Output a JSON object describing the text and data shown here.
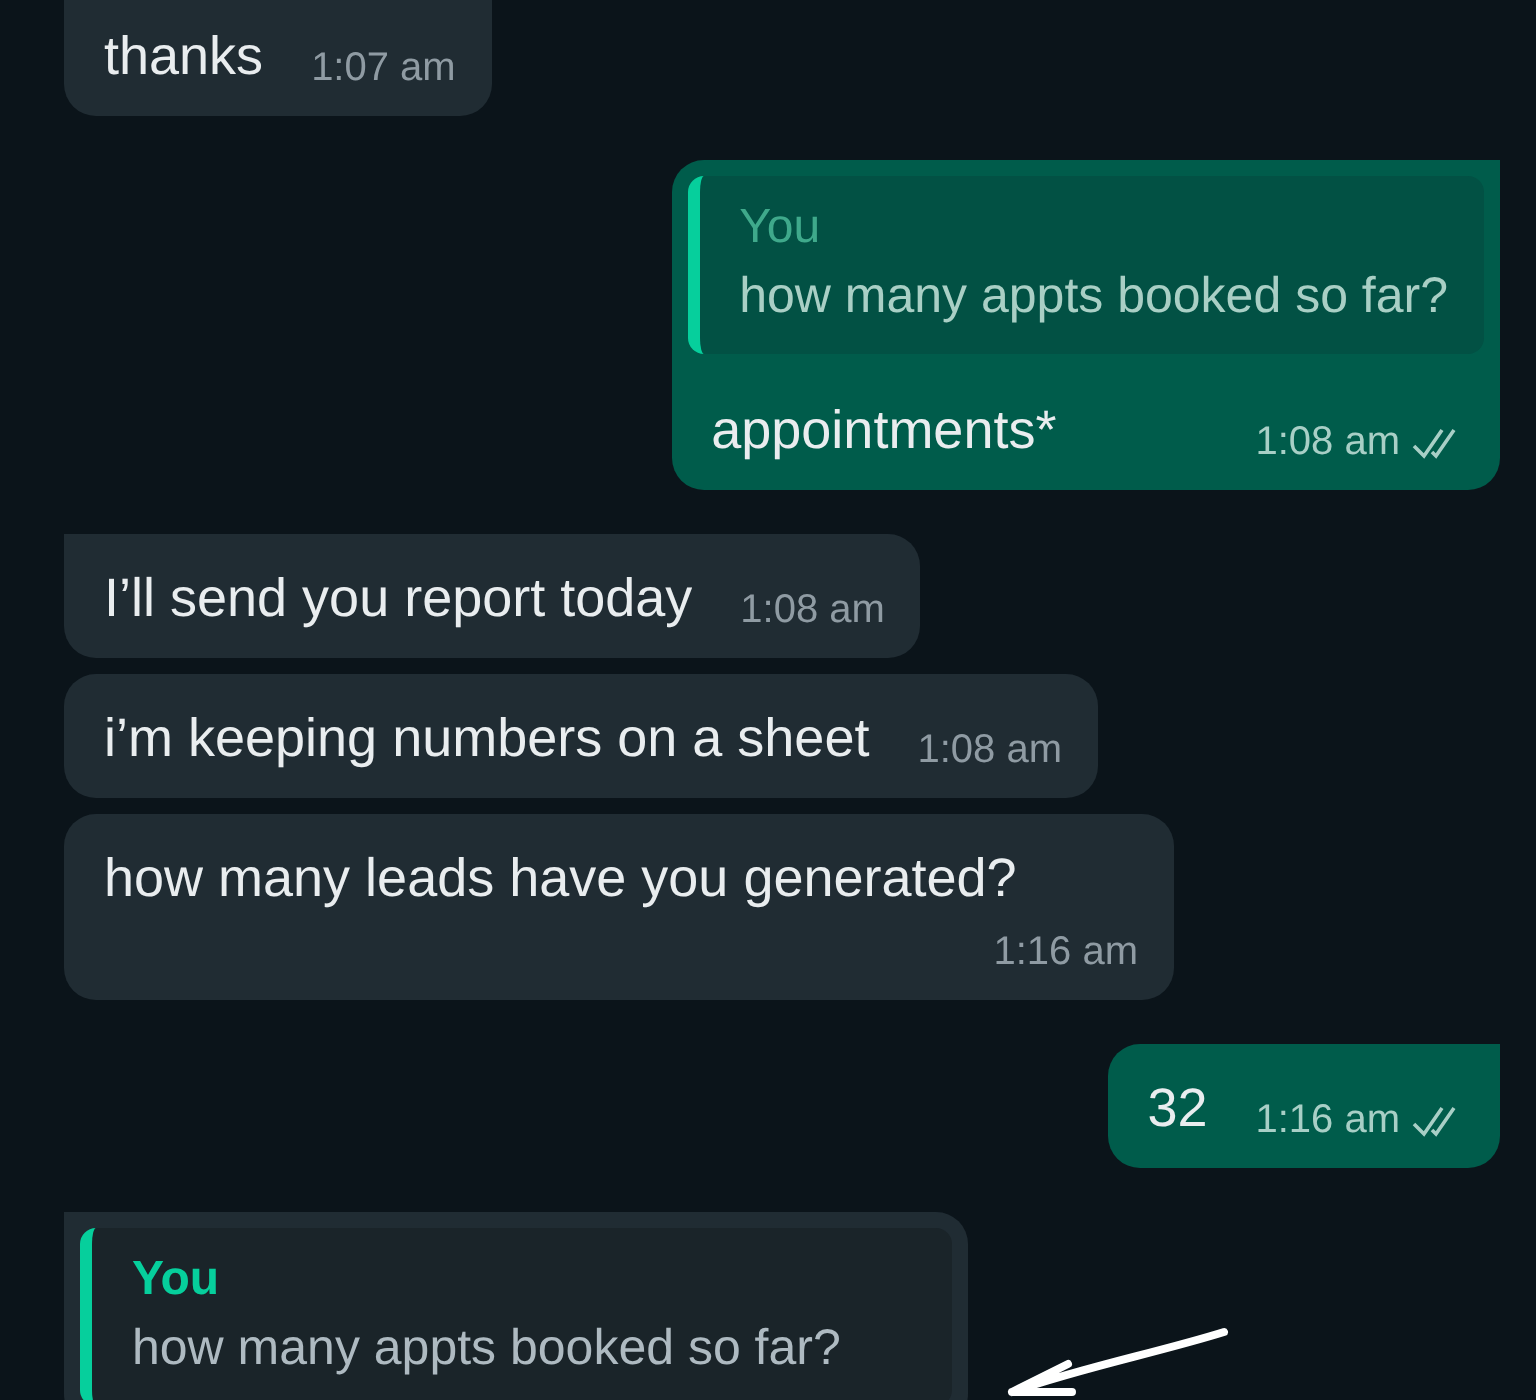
{
  "messages": [
    {
      "kind": "incoming",
      "text": "thanks",
      "time": "1:07 am"
    },
    {
      "kind": "outgoing",
      "tail": true,
      "quote": {
        "author": "You",
        "text": "how many appts booked so far?"
      },
      "text": "appointments*",
      "time": "1:08 am",
      "read": false
    },
    {
      "kind": "incoming",
      "tail": true,
      "text": "I’ll send you report today",
      "time": "1:08 am"
    },
    {
      "kind": "incoming",
      "tail": false,
      "text": "i’m keeping numbers on a sheet",
      "time": "1:08 am"
    },
    {
      "kind": "incoming",
      "tail": false,
      "text": "how many leads have you generated?",
      "time": "1:16 am"
    },
    {
      "kind": "outgoing",
      "tail": true,
      "text": "32",
      "time": "1:16 am",
      "read": false
    },
    {
      "kind": "incoming",
      "tail": true,
      "quote": {
        "author": "You",
        "text": "how many appts booked so far?"
      }
    }
  ]
}
